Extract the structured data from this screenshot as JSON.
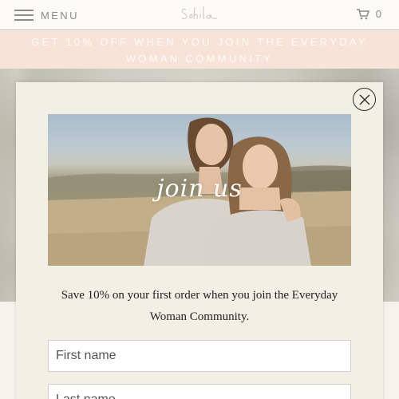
{
  "header": {
    "menu_label": "MENU",
    "logo_icon": "sohila-script-logo",
    "cart_icon": "shopping-cart-icon",
    "cart_count": "0"
  },
  "banner": {
    "text": "GET 10% OFF WHEN YOU JOIN THE EVERYDAY WOMAN COMMUNITY"
  },
  "modal": {
    "close_icon": "close-icon",
    "image_caption": "join us",
    "promo_text": "Save 10% on your first order when you join the Everyday Woman Community.",
    "first_name_placeholder": "First name",
    "last_name_placeholder": "Last name"
  },
  "colors": {
    "banner_bg": "#f8e3d9",
    "modal_bg": "#f2efe4",
    "header_text": "#8f8c86"
  }
}
